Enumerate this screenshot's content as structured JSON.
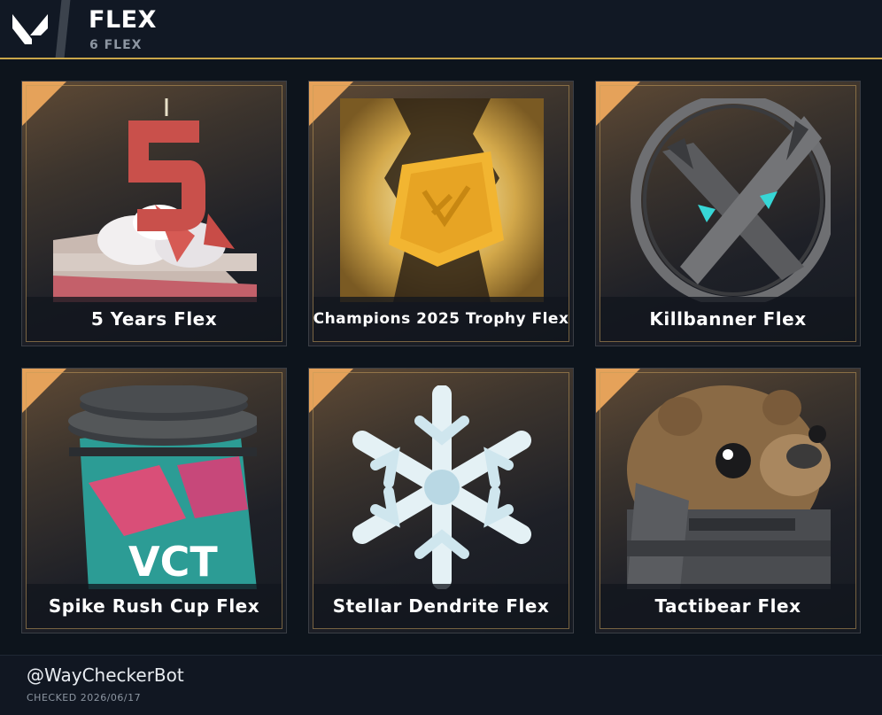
{
  "header": {
    "title": "FLEX",
    "subtitle": "6 FLEX",
    "logo_icon": "valorant-logo-icon",
    "accent": "#c9a54a"
  },
  "items": [
    {
      "label": "5 Years Flex",
      "icon": "birthday-cake-5-icon"
    },
    {
      "label": "Champions 2025 Trophy Flex",
      "icon": "champions-trophy-icon"
    },
    {
      "label": "Killbanner Flex",
      "icon": "killbanner-icon"
    },
    {
      "label": "Spike Rush Cup Flex",
      "icon": "vct-coffee-cup-icon"
    },
    {
      "label": "Stellar Dendrite Flex",
      "icon": "snowflake-icon"
    },
    {
      "label": "Tactibear Flex",
      "icon": "tactibear-icon"
    }
  ],
  "footer": {
    "handle": "@WayCheckerBot",
    "checked": "CHECKED 2026/06/17"
  }
}
